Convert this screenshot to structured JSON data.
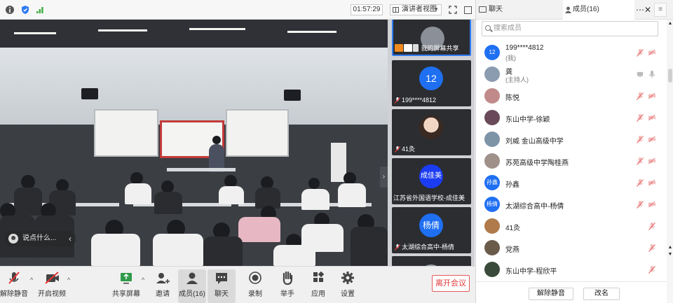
{
  "topbar": {
    "timer": "01:57:29",
    "view_label": "演讲者视图"
  },
  "video": {
    "annotation_text": "说点什么..."
  },
  "tiles": [
    {
      "name": "我的屏幕共享",
      "type": "photo"
    },
    {
      "name": "199****4812",
      "avatar_text": "12",
      "color": "#1f6ff2"
    },
    {
      "name": "41灸",
      "type": "photo"
    },
    {
      "name": "江苏省外国语学校-成佳美",
      "avatar_text": "成佳美",
      "color": "#1b3cf2"
    },
    {
      "name": "太湖综合高中-杨倩",
      "avatar_text": "杨倩",
      "color": "#1f6ff2"
    },
    {
      "name": "",
      "type": "photo"
    }
  ],
  "toolbar": {
    "unmute": "解除静音",
    "start_video": "开启视频",
    "share_screen": "共享屏幕",
    "invite": "邀请",
    "members": "成员(16)",
    "chat": "聊天",
    "record": "录制",
    "raise_hand": "举手",
    "apps": "应用",
    "settings": "设置",
    "leave": "离开会议"
  },
  "panel": {
    "tab_chat": "聊天",
    "tab_members": "成员(16)",
    "more": "⋯",
    "close": "✕",
    "menu": "≡",
    "search_placeholder": "搜索成员",
    "members": [
      {
        "name": "199****4812",
        "sub": "(我)",
        "avatar_text": "12",
        "color": "#1f6ff2",
        "mic": "muted",
        "cam": "off"
      },
      {
        "name": "龚",
        "sub": "(主持人)",
        "avatar_text": "",
        "color": "#8b9bb0",
        "mic": "on",
        "cam": "share"
      },
      {
        "name": "陈悦",
        "avatar_text": "",
        "color": "#c08a8a",
        "mic": "muted",
        "cam": "off"
      },
      {
        "name": "东山中学-徐颖",
        "avatar_text": "",
        "color": "#6a4a5a",
        "mic": "muted",
        "cam": "off"
      },
      {
        "name": "刘威 金山高级中学",
        "avatar_text": "",
        "color": "#7d93a6",
        "mic": "muted",
        "cam": "off"
      },
      {
        "name": "苏苑高级中学陶桂燕",
        "avatar_text": "",
        "color": "#a0908a",
        "mic": "muted",
        "cam": "off"
      },
      {
        "name": "孙鑫",
        "avatar_text": "孙鑫",
        "color": "#1f6ff2",
        "mic": "muted",
        "cam": "off"
      },
      {
        "name": "太湖综合高中-杨倩",
        "avatar_text": "杨倩",
        "color": "#1f6ff2",
        "mic": "muted",
        "cam": "off"
      },
      {
        "name": "41灸",
        "avatar_text": "",
        "color": "#b07a4a",
        "mic": "muted",
        "cam": ""
      },
      {
        "name": "党燕",
        "avatar_text": "",
        "color": "#6a5a4a",
        "mic": "muted",
        "cam": ""
      },
      {
        "name": "东山中学-程欣平",
        "avatar_text": "",
        "color": "#3a4a3a",
        "mic": "muted",
        "cam": ""
      }
    ],
    "unmute_btn": "解除静音",
    "rename_btn": "改名"
  }
}
